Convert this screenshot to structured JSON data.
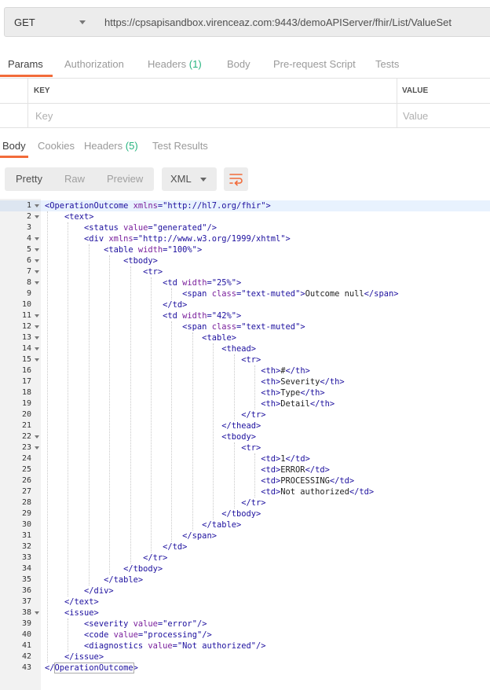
{
  "request": {
    "method": "GET",
    "url": "https://cpsapisandbox.virenceaz.com:9443/demoAPIServer/fhir/List/ValueSet"
  },
  "request_tabs": [
    {
      "label": "Params",
      "count": ""
    },
    {
      "label": "Authorization",
      "count": ""
    },
    {
      "label": "Headers",
      "count": "(1)"
    },
    {
      "label": "Body",
      "count": ""
    },
    {
      "label": "Pre-request Script",
      "count": ""
    },
    {
      "label": "Tests",
      "count": ""
    }
  ],
  "params_table": {
    "key_header": "KEY",
    "value_header": "VALUE",
    "key_placeholder": "Key",
    "value_placeholder": "Value"
  },
  "response_tabs": [
    {
      "label": "Body",
      "count": ""
    },
    {
      "label": "Cookies",
      "count": ""
    },
    {
      "label": "Headers",
      "count": "(5)"
    },
    {
      "label": "Test Results",
      "count": ""
    }
  ],
  "view_modes": [
    "Pretty",
    "Raw",
    "Preview"
  ],
  "active_view_mode": "Pretty",
  "format": "XML",
  "colors": {
    "accent": "#f26b3a",
    "count": "#26b47f",
    "tag": "#1c0f9e",
    "attr": "#7a1f9c"
  },
  "code_lines": [
    "<OperationOutcome xmlns=\"http://hl7.org/fhir\">",
    "    <text>",
    "        <status value=\"generated\"/>",
    "        <div xmlns=\"http://www.w3.org/1999/xhtml\">",
    "            <table width=\"100%\">",
    "                <tbody>",
    "                    <tr>",
    "                        <td width=\"25%\">",
    "                            <span class=\"text-muted\">Outcome null</span>",
    "                        </td>",
    "                        <td width=\"42%\">",
    "                            <span class=\"text-muted\">",
    "                                <table>",
    "                                    <thead>",
    "                                        <tr>",
    "                                            <th>#</th>",
    "                                            <th>Severity</th>",
    "                                            <th>Type</th>",
    "                                            <th>Detail</th>",
    "                                        </tr>",
    "                                    </thead>",
    "                                    <tbody>",
    "                                        <tr>",
    "                                            <td>1</td>",
    "                                            <td>ERROR</td>",
    "                                            <td>PROCESSING</td>",
    "                                            <td>Not authorized</td>",
    "                                        </tr>",
    "                                    </tbody>",
    "                                </table>",
    "                            </span>",
    "                        </td>",
    "                    </tr>",
    "                </tbody>",
    "            </table>",
    "        </div>",
    "    </text>",
    "    <issue>",
    "        <severity value=\"error\"/>",
    "        <code value=\"processing\"/>",
    "        <diagnostics value=\"Not authorized\"/>",
    "    </issue>",
    "</OperationOutcome>"
  ],
  "folded_lines": [
    1,
    2,
    4,
    5,
    6,
    7,
    8,
    11,
    12,
    13,
    14,
    15,
    22,
    23,
    38
  ]
}
